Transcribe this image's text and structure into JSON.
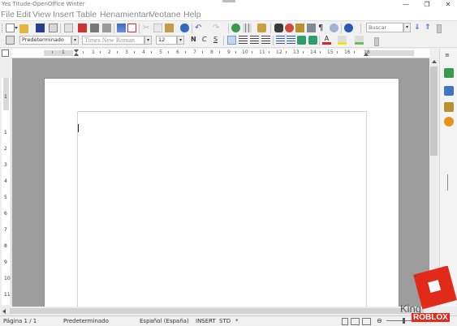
{
  "window": {
    "title": "Yes Titude-OpenOffice Winter",
    "minimize": "—",
    "maximize": "❐",
    "close": "✕"
  },
  "menubar": {
    "items": [
      "File",
      "Edit",
      "View",
      "Insert",
      "Table",
      "Henamientan",
      "Veotane",
      "Help"
    ]
  },
  "toolbar_standard": {
    "search_placeholder": "Buscar",
    "search_value": "Buscar"
  },
  "toolbar_format": {
    "style": "Predeterminado",
    "font": "Times New Roman",
    "size": "12",
    "bold": "N",
    "italic": "C",
    "underline": "S"
  },
  "ruler": {
    "labels": [
      "1",
      "1",
      "2",
      "3",
      "4",
      "5",
      "6",
      "7",
      "8",
      "9",
      "10",
      "11",
      "12",
      "13",
      "14",
      "15",
      "16",
      "18"
    ]
  },
  "vertical_ruler": {
    "labels": [
      "1",
      "1",
      "2",
      "3",
      "4",
      "5",
      "6",
      "7",
      "8",
      "9",
      "10",
      "11"
    ]
  },
  "statusbar": {
    "page": "Página  1 / 1",
    "style": "Predeterminado",
    "language": "Español (España)",
    "insert_mode": "INSERT",
    "selection_mode": "STD",
    "doc_modified": "*"
  },
  "watermark": {
    "text_king": "King",
    "text_roblox": "ROBLOX"
  },
  "colors": {
    "workspace": "#9d9d9d",
    "page": "#ffffff",
    "watermark_red": "#e22a1b"
  },
  "icons": {
    "sidebar": [
      "properties-icon",
      "navigator-icon",
      "gallery-icon",
      "styles-icon",
      "compass-icon"
    ]
  }
}
